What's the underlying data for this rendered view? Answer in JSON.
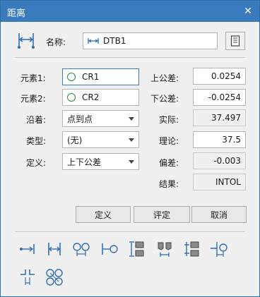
{
  "window": {
    "title": "距离"
  },
  "header": {
    "name_label": "名称:",
    "name_value": "DTB1"
  },
  "elements": {
    "elem1_label": "元素1:",
    "elem1_value": "CR1",
    "elem2_label": "元素2:",
    "elem2_value": "CR2",
    "along_label": "沿着:",
    "along_value": "点到点",
    "type_label": "类型:",
    "type_value": "(无)",
    "define_label": "定义:",
    "define_value": "上下公差"
  },
  "values": {
    "upper_tol_label": "上公差:",
    "upper_tol": "0.0254",
    "lower_tol_label": "下公差:",
    "lower_tol": "-0.0254",
    "actual_label": "实际:",
    "actual": "37.497",
    "nominal_label": "理论:",
    "nominal": "37.5",
    "deviation_label": "偏差:",
    "deviation": "-0.003",
    "result_label": "结果:",
    "result": "INTOL"
  },
  "buttons": {
    "define": "定义",
    "evaluate": "评定",
    "cancel": "取消"
  },
  "icons": [
    "distance-point-to-point-icon",
    "distance-parallel-icon",
    "distance-circle-to-circle-icon",
    "distance-point-to-line-icon",
    "distance-vertical-icon",
    "distance-angled-icon",
    "distance-vertical-stepped-icon",
    "distance-line-to-circle-icon",
    "distance-gap-icon",
    "distance-four-circles-icon"
  ],
  "colors": {
    "titlebar": "#3a7bbd",
    "icon_blue": "#2f6db5",
    "circle_green": "#2a8a3a"
  }
}
